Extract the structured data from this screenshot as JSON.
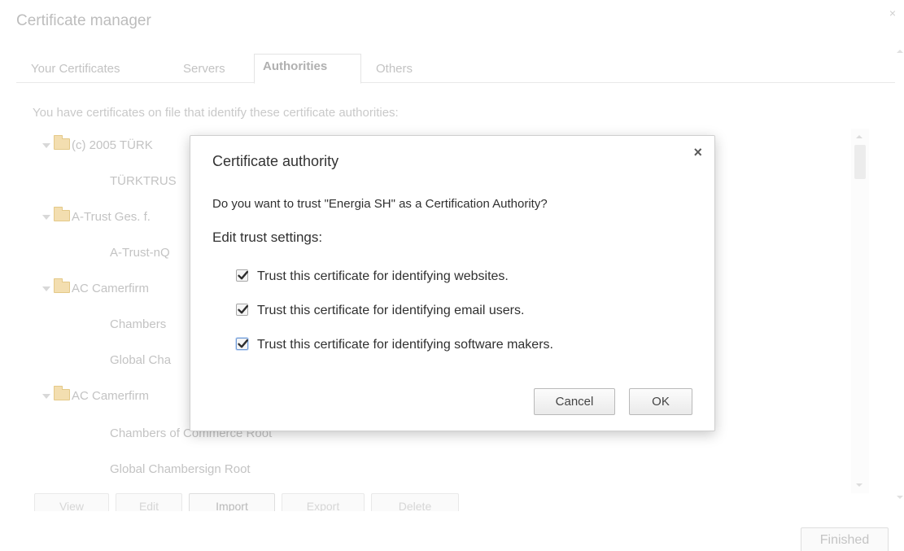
{
  "background": {
    "title": "Certificate manager",
    "close_glyph": "×",
    "tabs": [
      {
        "label": "Your Certificates"
      },
      {
        "label": "Servers"
      },
      {
        "label": "Authorities",
        "active": true
      },
      {
        "label": "Others"
      }
    ],
    "description": "You have certificates on file that identify these certificate authorities:",
    "tree": [
      {
        "kind": "parent",
        "label": "(c) 2005 TÜRK"
      },
      {
        "kind": "child",
        "label": "TÜRKTRUS"
      },
      {
        "kind": "parent",
        "label": "A-Trust Ges. f."
      },
      {
        "kind": "child",
        "label": "A-Trust-nQ"
      },
      {
        "kind": "parent",
        "label": "AC Camerfirm"
      },
      {
        "kind": "child",
        "label": "Chambers"
      },
      {
        "kind": "child",
        "label": "Global Cha"
      },
      {
        "kind": "parent",
        "label": "AC Camerfirm"
      },
      {
        "kind": "child",
        "label": "Chambers of Commerce Root"
      },
      {
        "kind": "child",
        "label": "Global Chambersign Root"
      }
    ],
    "buttons": [
      {
        "label": "View"
      },
      {
        "label": "Edit"
      },
      {
        "label": "Import"
      },
      {
        "label": "Export"
      },
      {
        "label": "Delete"
      }
    ],
    "finished_label": "Finished"
  },
  "modal": {
    "title": "Certificate authority",
    "close_glyph": "×",
    "question": "Do you want to trust \"Energia SH\" as a Certification Authority?",
    "edit_label": "Edit trust settings:",
    "options": [
      {
        "label": "Trust this certificate for identifying websites.",
        "checked": true
      },
      {
        "label": "Trust this certificate for identifying email users.",
        "checked": true
      },
      {
        "label": "Trust this certificate for identifying software makers.",
        "checked": true,
        "focused": true
      }
    ],
    "cancel_label": "Cancel",
    "ok_label": "OK"
  },
  "icons": {
    "folder": "folder-icon",
    "expand": "triangle-down-icon",
    "check": "checkmark-icon",
    "close": "close-icon"
  },
  "colors": {
    "focus_ring": "#6f9ad6",
    "folder_fill": "#f3deb0"
  }
}
